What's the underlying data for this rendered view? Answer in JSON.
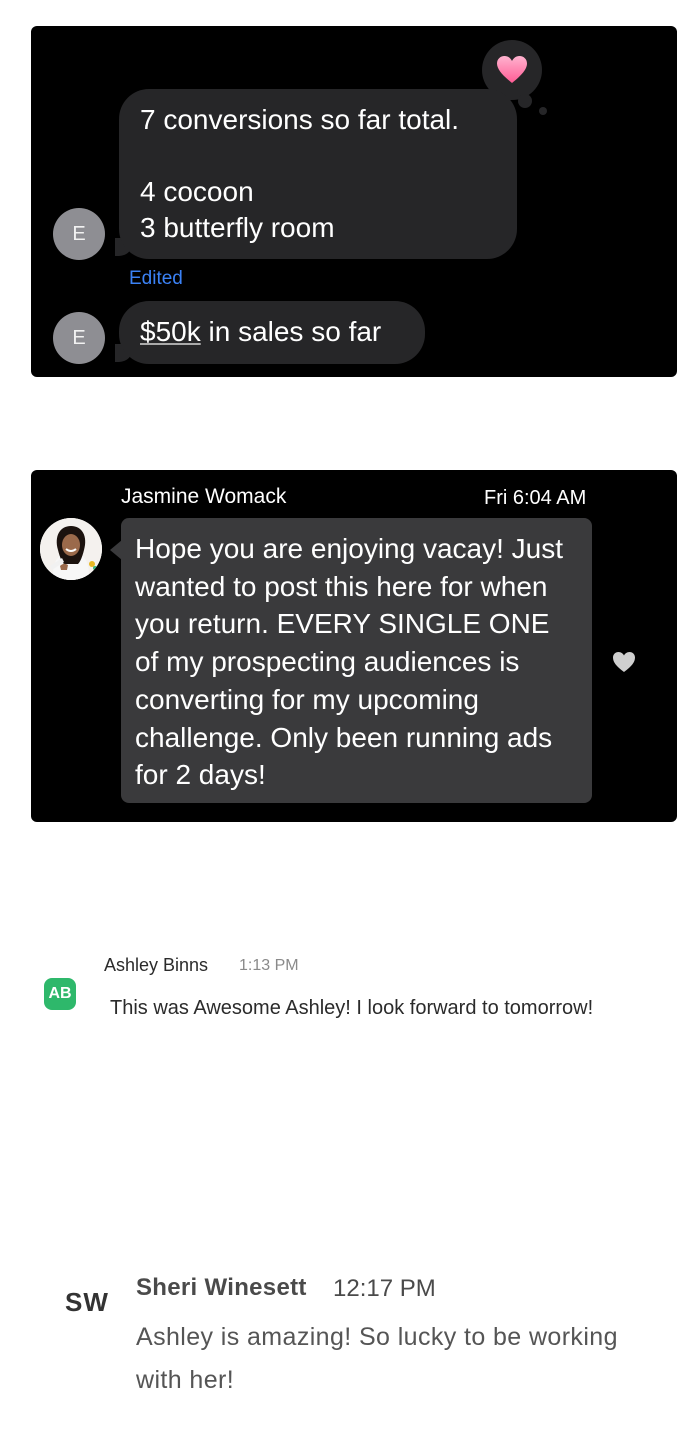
{
  "panel1": {
    "reaction": "heart",
    "messages": [
      {
        "avatar": "E",
        "lines": [
          "7 conversions so far total.",
          "",
          "4 cocoon",
          "3 butterfly room"
        ]
      },
      {
        "avatar": "E",
        "link_text": "$50k",
        "rest_text": " in sales so far"
      }
    ],
    "edited_label": "Edited"
  },
  "panel2": {
    "sender": "Jasmine Womack",
    "time": "Fri 6:04 AM",
    "message": "Hope you are enjoying vacay! Just wanted to post this here for when you return. EVERY SINGLE ONE of my prospecting audiences is converting for my upcoming challenge. Only been running ads for 2 days!"
  },
  "chat1": {
    "avatar": "AB",
    "sender": "Ashley Binns",
    "time": "1:13 PM",
    "message": "This was Awesome Ashley! I look forward to tomorrow!"
  },
  "chat2": {
    "avatar": "SW",
    "sender": "Sheri Winesett",
    "time": "12:17 PM",
    "message_line1": "Ashley is amazing! So lucky to be working",
    "message_line2": "with her!"
  },
  "colors": {
    "panel_bg": "#000000",
    "bubble_dark": "#262628",
    "bubble_gray": "#3a3a3c",
    "edited_blue": "#3b82f6",
    "ab_green": "#2eb86b",
    "heart_pink": "#ff6fa3"
  }
}
